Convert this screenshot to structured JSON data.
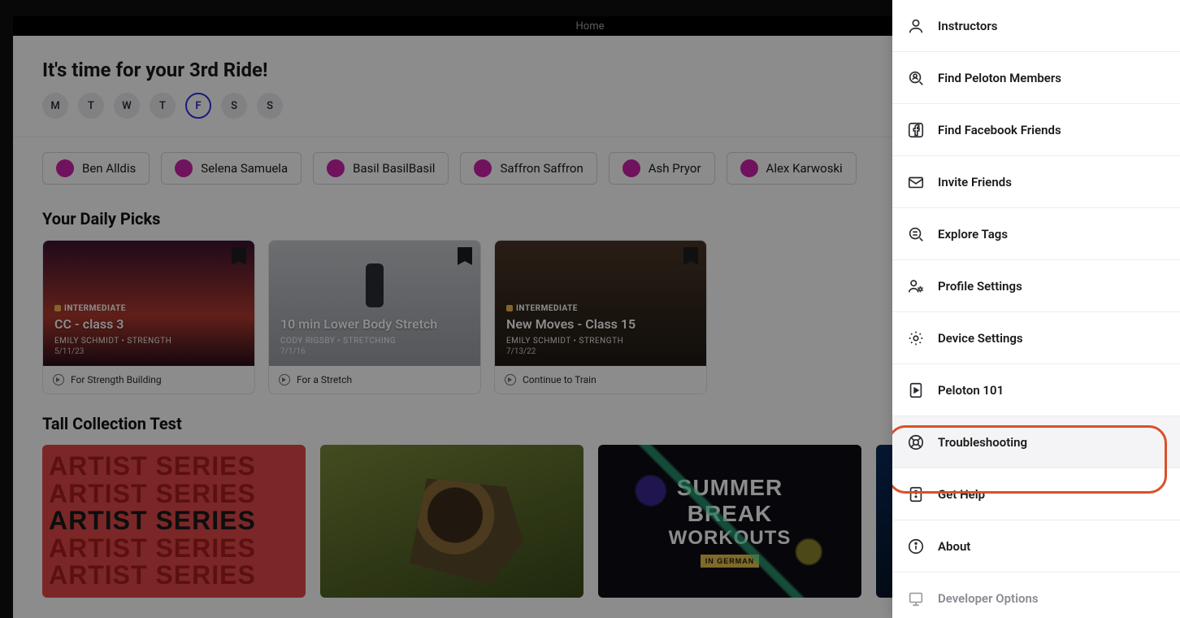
{
  "topbar": {
    "title": "Home"
  },
  "hero": {
    "title": "It's time for your 3rd Ride!",
    "days": [
      "M",
      "T",
      "W",
      "T",
      "F",
      "S",
      "S"
    ],
    "activeIndex": 4
  },
  "instructors": [
    {
      "name": "Ben Alldis"
    },
    {
      "name": "Selena Samuela"
    },
    {
      "name": "Basil BasilBasil"
    },
    {
      "name": "Saffron Saffron"
    },
    {
      "name": "Ash Pryor"
    },
    {
      "name": "Alex Karwoski"
    }
  ],
  "dailyPicks": {
    "heading": "Your Daily Picks",
    "cards": [
      {
        "level": "INTERMEDIATE",
        "title": "CC - class 3",
        "meta": "EMILY SCHMIDT  •  STRENGTH",
        "date": "5/11/23",
        "footer": "For Strength Building"
      },
      {
        "level": "",
        "title": "10 min Lower Body Stretch",
        "meta": "CODY RIGSBY  •  STRETCHING",
        "date": "7/1/16",
        "footer": "For a Stretch"
      },
      {
        "level": "INTERMEDIATE",
        "title": "New Moves - Class 15",
        "meta": "EMILY SCHMIDT  •  STRENGTH",
        "date": "7/13/22",
        "footer": "Continue to Train"
      }
    ]
  },
  "collection": {
    "heading": "Tall Collection Test",
    "artistLine": "ARTIST SERIES",
    "summer": {
      "l1": "SUMMER",
      "l2": "BREAK",
      "l3": "WORKOUTS",
      "badge": "IN GERMAN"
    }
  },
  "menu": {
    "items": [
      {
        "label": "Instructors",
        "icon": "person"
      },
      {
        "label": "Find Peloton Members",
        "icon": "search-person"
      },
      {
        "label": "Find Facebook Friends",
        "icon": "facebook"
      },
      {
        "label": "Invite Friends",
        "icon": "mail"
      },
      {
        "label": "Explore Tags",
        "icon": "search-tag"
      },
      {
        "label": "Profile Settings",
        "icon": "profile-gear"
      },
      {
        "label": "Device Settings",
        "icon": "gear"
      },
      {
        "label": "Peloton 101",
        "icon": "play-doc"
      },
      {
        "label": "Troubleshooting",
        "icon": "lifebuoy",
        "highlighted": true
      },
      {
        "label": "Get Help",
        "icon": "help-doc"
      },
      {
        "label": "About",
        "icon": "info"
      },
      {
        "label": "Developer Options",
        "icon": "dev",
        "muted": true
      }
    ]
  }
}
